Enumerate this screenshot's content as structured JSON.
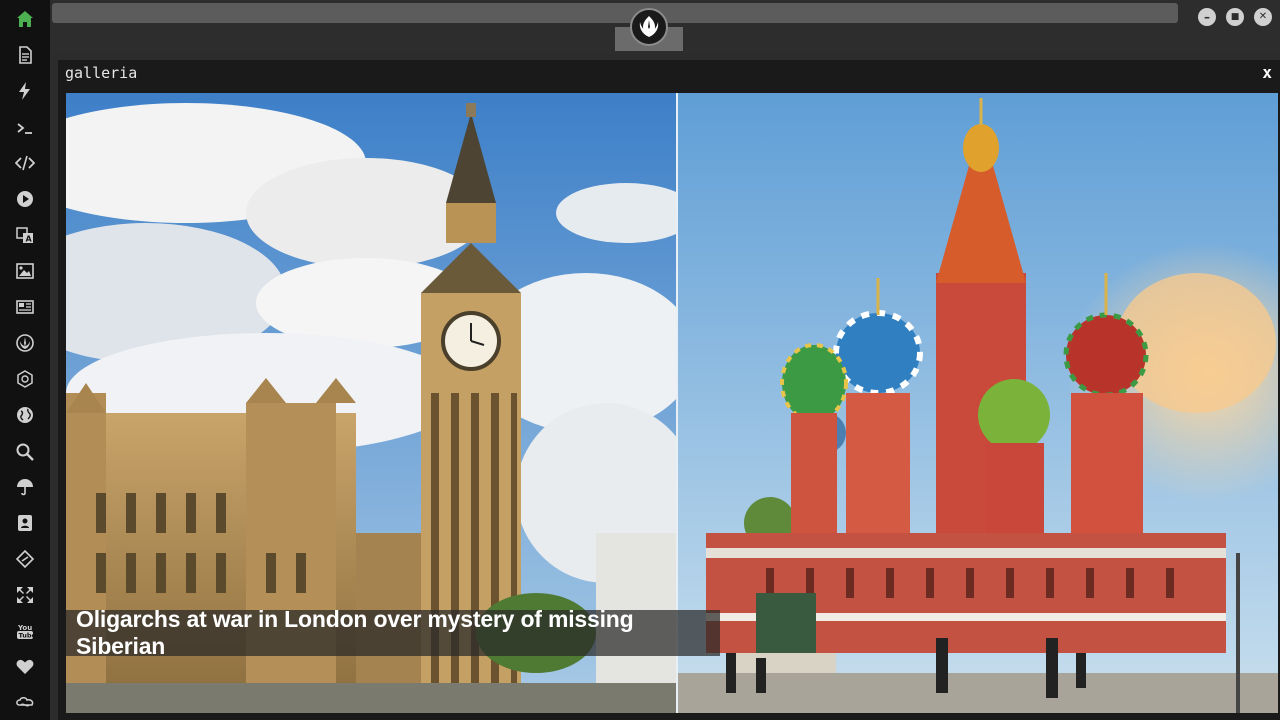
{
  "sidebar": {
    "items": [
      {
        "name": "home-icon",
        "active": true
      },
      {
        "name": "document-icon"
      },
      {
        "name": "lightning-icon"
      },
      {
        "name": "terminal-icon"
      },
      {
        "name": "code-icon"
      },
      {
        "name": "play-icon"
      },
      {
        "name": "translate-icon"
      },
      {
        "name": "image-icon"
      },
      {
        "name": "newspaper-icon"
      },
      {
        "name": "rebel-alliance-icon"
      },
      {
        "name": "empire-icon"
      },
      {
        "name": "globe-icon"
      },
      {
        "name": "search-icon"
      },
      {
        "name": "umbrella-icon"
      },
      {
        "name": "contact-card-icon"
      },
      {
        "name": "dev-code-icon"
      },
      {
        "name": "expand-arrows-icon"
      },
      {
        "name": "youtube-icon"
      },
      {
        "name": "heart-icon"
      },
      {
        "name": "infinity-cloud-icon"
      }
    ],
    "active_color": "#4caf50",
    "icon_color": "#d0d0d0"
  },
  "window": {
    "minimize_label": "–",
    "maximize_label": "■",
    "close_label": "✕"
  },
  "gallery": {
    "title": "galleria",
    "close_label": "x",
    "caption": "Oligarchs at war in London over mystery of missing Siberian"
  }
}
